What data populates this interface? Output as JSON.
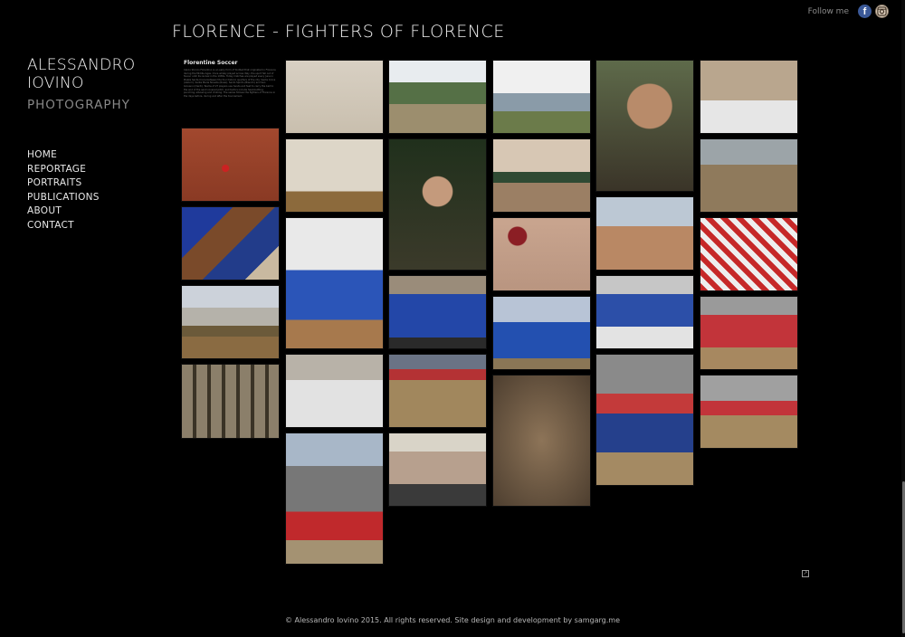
{
  "header": {
    "follow_label": "Follow me",
    "title": "FLORENCE - FIGHTERS OF FLORENCE"
  },
  "logo": {
    "line1": "ALESSANDRO",
    "line2": "IOVINO",
    "line3": "PHOTOGRAPHY"
  },
  "nav": {
    "home": "HOME",
    "reportage": "REPORTAGE",
    "portraits": "PORTRAITS",
    "publications": "PUBLICATIONS",
    "about": "ABOUT",
    "contact": "CONTACT"
  },
  "intro": {
    "heading": "Florentine Soccer",
    "body": "Calcio Storico Fiorentino is an early form of football that originated in Florence during the Middle Ages. Once widely played across Italy, the sport fell out of favour until its revival in the 1930s. Today matches are played every June in Piazza Santa Croce between the four historic quarters of the city: Santa Croce (Azzurri), Santa Maria Novella (Rossi), Santo Spirito (Bianchi) and San Giovanni (Verdi). Teams of 27 players use hands and feet to carry the ball to the end of the sand covered pitch, and tactics include head-butting, punching, elbowing and choking. The series follows the fighters of Florence in the days before, during and after the tournament."
  },
  "footer": {
    "text": "© Alessandro Iovino 2015. All rights reserved. Site design and development by samgarg.me"
  },
  "colors": {
    "background": "#000000",
    "facebook": "#3b5998",
    "instagram": "#d7c8b6"
  },
  "icons": [
    "facebook-icon",
    "instagram-icon",
    "expand-icon"
  ]
}
